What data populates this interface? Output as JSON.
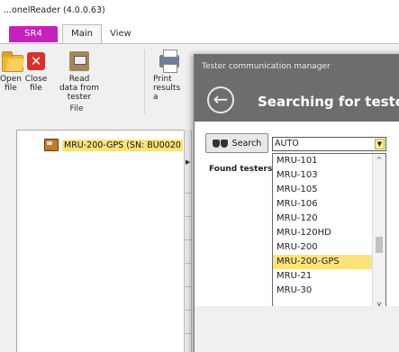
{
  "window": {
    "title": "...onelReader (4.0.0.63)"
  },
  "tabs": {
    "sr4": "SR4",
    "main": "Main",
    "view": "View"
  },
  "ribbon": {
    "open_label": "Open\nfile",
    "close_label": "Close\nfile",
    "read_label": "Read\ndata from tester",
    "print_label": "Print\nresults a",
    "group_file": "File"
  },
  "tree": {
    "device_label": "MRU-200-GPS (SN: BU0020"
  },
  "dialog": {
    "title": "Tester communication manager",
    "heading": "Searching for tester",
    "search_label": "Search",
    "combo_value": "AUTO",
    "found_label": "Found testers:",
    "options": [
      "MRU-101",
      "MRU-103",
      "MRU-105",
      "MRU-106",
      "MRU-120",
      "MRU-120HD",
      "MRU-200",
      "MRU-200-GPS",
      "MRU-21",
      "MRU-30"
    ],
    "selected_option": "MRU-200-GPS"
  }
}
